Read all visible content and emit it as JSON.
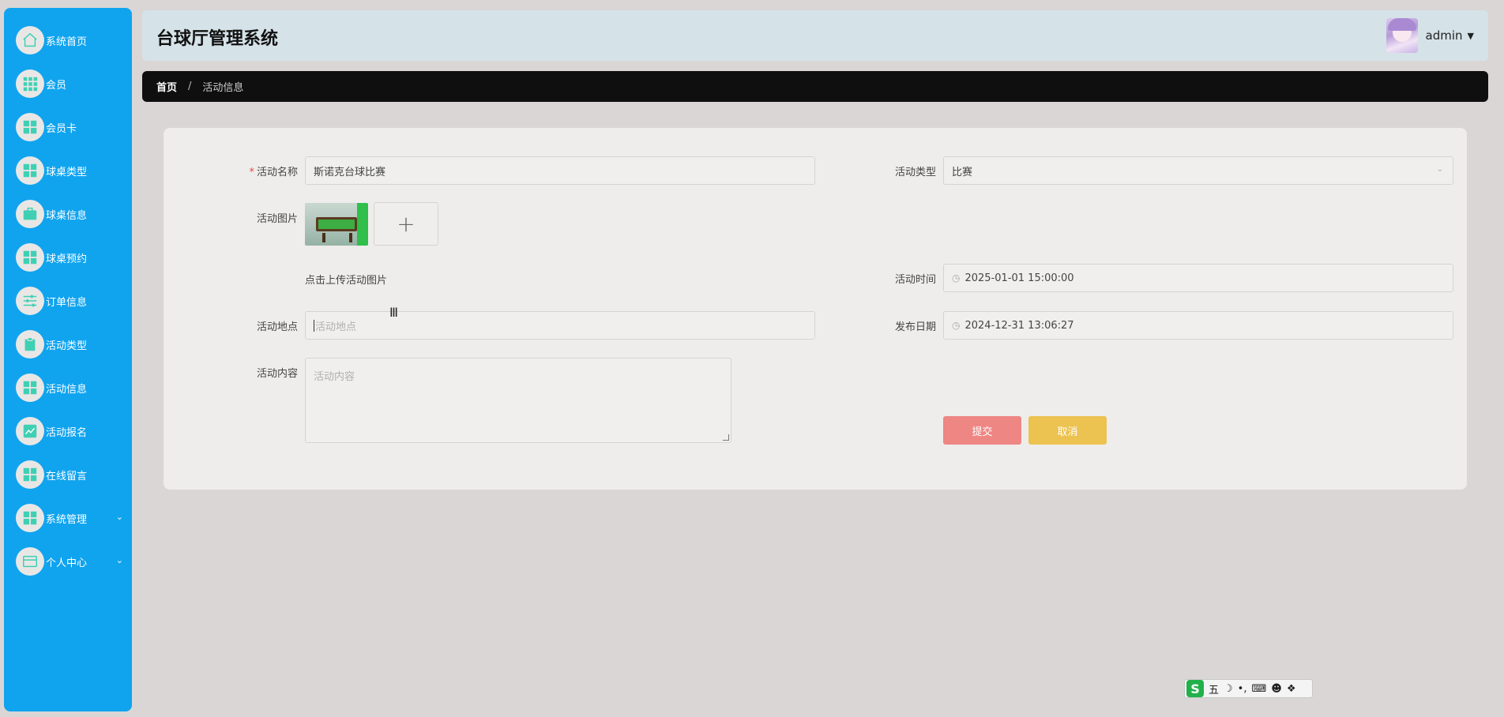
{
  "sidebar": {
    "items": [
      {
        "label": "系统首页",
        "icon": "home-icon"
      },
      {
        "label": "会员",
        "icon": "grid-icon"
      },
      {
        "label": "会员卡",
        "icon": "grid-icon"
      },
      {
        "label": "球桌类型",
        "icon": "grid-icon"
      },
      {
        "label": "球桌信息",
        "icon": "briefcase-icon"
      },
      {
        "label": "球桌预约",
        "icon": "grid-icon"
      },
      {
        "label": "订单信息",
        "icon": "sliders-icon"
      },
      {
        "label": "活动类型",
        "icon": "clipboard-icon"
      },
      {
        "label": "活动信息",
        "icon": "grid-icon"
      },
      {
        "label": "活动报名",
        "icon": "chart-icon"
      },
      {
        "label": "在线留言",
        "icon": "grid-icon"
      },
      {
        "label": "系统管理",
        "icon": "grid-icon"
      },
      {
        "label": "个人中心",
        "icon": "card-icon"
      }
    ]
  },
  "header": {
    "title": "台球厅管理系统",
    "username": "admin",
    "caret": "▼"
  },
  "breadcrumb": {
    "home": "首页",
    "separator": "/",
    "current": "活动信息"
  },
  "form": {
    "name_label": "活动名称",
    "required_mark": "*",
    "name_value": "斯诺克台球比赛",
    "type_label": "活动类型",
    "type_value": "比赛",
    "image_label": "活动图片",
    "upload_plus": "+",
    "upload_hint": "点击上传活动图片",
    "time_label": "活动时间",
    "time_value": "2025-01-01 15:00:00",
    "location_label": "活动地点",
    "location_placeholder": "活动地点",
    "publish_label": "发布日期",
    "publish_value": "2024-12-31 13:06:27",
    "content_label": "活动内容",
    "content_placeholder": "活动内容",
    "submit": "提交",
    "cancel": "取消"
  },
  "ime": {
    "logo": "S",
    "mode": "五"
  },
  "colors": {
    "sidebar": "#10a4ef",
    "icon_accent": "#3fd0b4",
    "submit": "#ee8684",
    "cancel": "#ecc250",
    "breadcrumb_bg": "#0f0f0f"
  }
}
